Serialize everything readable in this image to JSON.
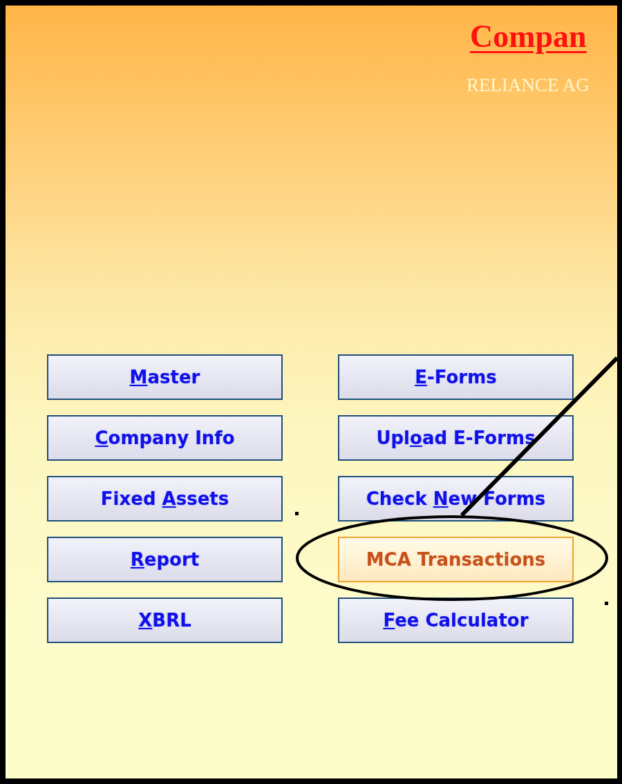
{
  "header": {
    "title": "Compan",
    "subtitle": "RELIANCE AG"
  },
  "left_buttons": [
    {
      "mnemonic": "M",
      "text_after": "aster",
      "selected": false
    },
    {
      "mnemonic": "C",
      "text_after": "ompany Info",
      "selected": false
    },
    {
      "text_before": "Fixed ",
      "mnemonic": "A",
      "text_after": "ssets",
      "selected": false
    },
    {
      "mnemonic": "R",
      "text_after": "eport",
      "selected": false
    },
    {
      "mnemonic": "X",
      "text_after": "BRL",
      "selected": false
    }
  ],
  "right_buttons": [
    {
      "mnemonic": "E",
      "text_after": "-Forms",
      "selected": false
    },
    {
      "text_before": "Upl",
      "mnemonic": "o",
      "text_after": "ad E-Forms",
      "selected": false
    },
    {
      "text_before": "Check ",
      "mnemonic": "N",
      "text_after": "ew Forms",
      "selected": false
    },
    {
      "text_before": "MCA Transactions",
      "selected": true
    },
    {
      "mnemonic": "F",
      "text_after": "ee Calculator",
      "selected": false
    }
  ]
}
